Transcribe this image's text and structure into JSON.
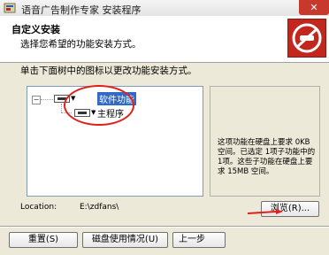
{
  "window": {
    "title": "语音广告制作专家 安装程序",
    "close_glyph": "✕"
  },
  "header": {
    "title": "自定义安装",
    "subtitle": "选择您希望的功能安装方式。"
  },
  "instruction": "单击下面树中的图标以更改功能安装方式。",
  "tree": {
    "root_label": "软件功能",
    "child_label": "主程序",
    "expand_glyph": "−"
  },
  "description": "这项功能在硬盘上要求 0KB 空间。已选定 1项子功能中的 1项。这些子功能在硬盘上要求 15MB 空间。",
  "location": {
    "label": "Location:",
    "value": "E:\\zdfans\\"
  },
  "buttons": {
    "browse": "浏览(R)...",
    "reset": "重置(S)",
    "disk_usage": "磁盘使用情况(U)",
    "back": "上一步"
  },
  "colors": {
    "accent_red": "#e0201a",
    "selection_blue": "#316ac5",
    "logo_red": "#c1271d"
  }
}
